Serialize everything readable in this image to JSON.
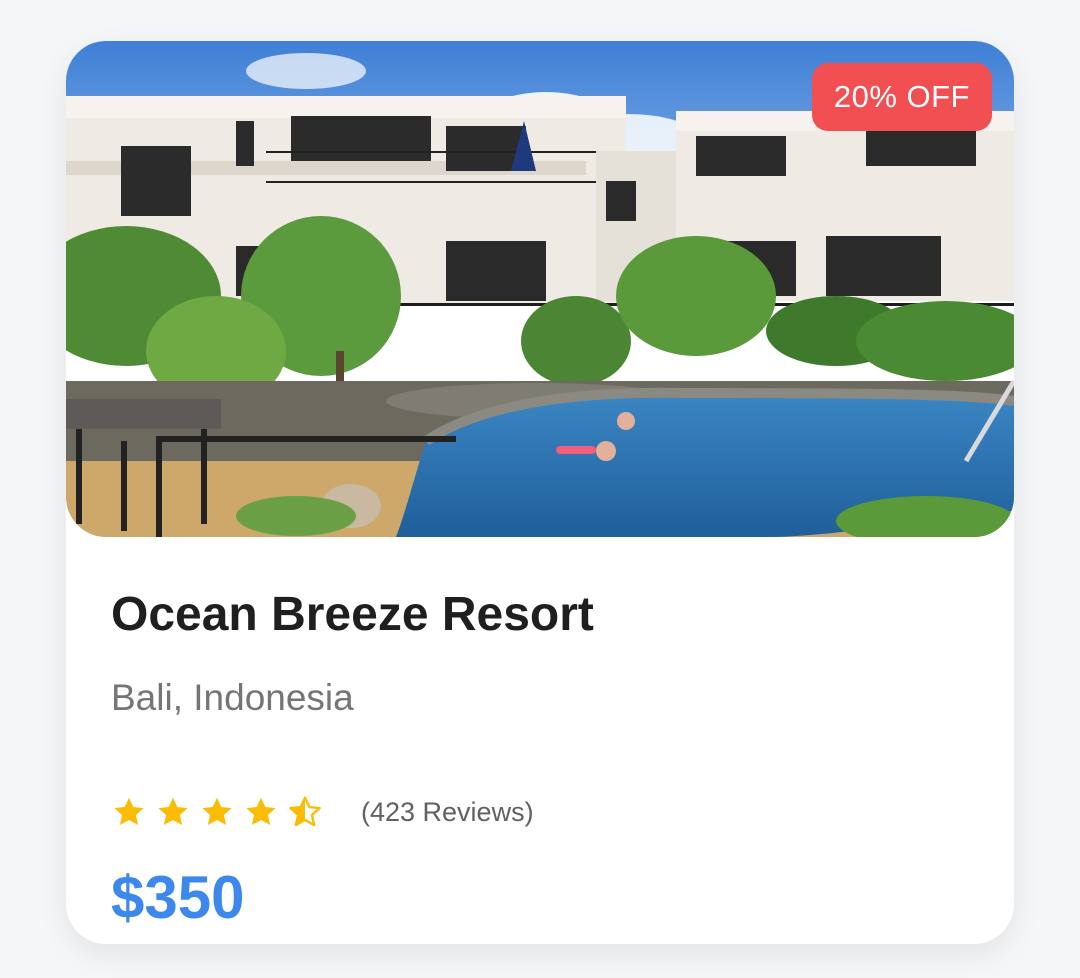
{
  "card": {
    "discount_badge": "20% OFF",
    "image_alt": "Resort building with pool and garden",
    "title": "Ocean Breeze Resort",
    "location": "Bali, Indonesia",
    "rating": 4.5,
    "rating_max": 5,
    "reviews": "(423 Reviews)",
    "price": "$350"
  },
  "colors": {
    "badge": "#f24f52",
    "price": "#3d88ed",
    "star": "#fbbc05",
    "title": "#1f1f1f",
    "location": "#757575"
  },
  "icons": [
    "star-full-icon",
    "star-half-icon"
  ]
}
